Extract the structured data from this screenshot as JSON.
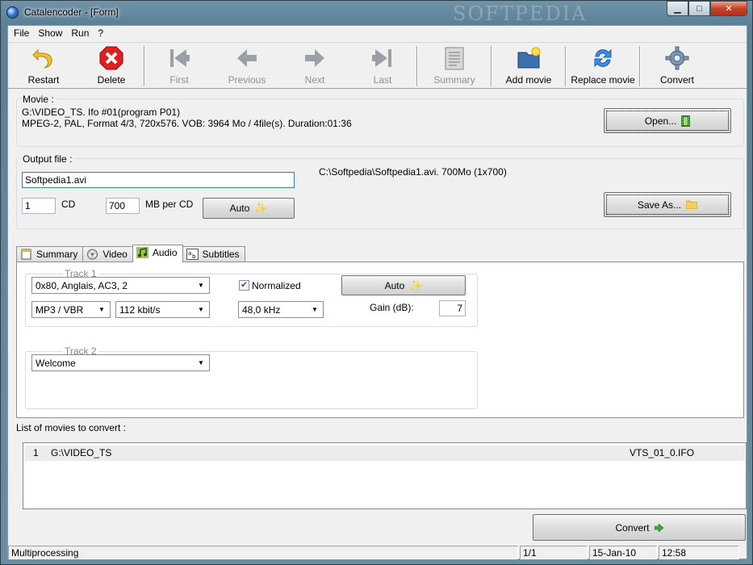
{
  "window": {
    "title": "Catalencoder - [Form]",
    "watermark": "SOFTPEDIA",
    "controls": {
      "minimize": "▁",
      "maximize": "□",
      "close": "✕"
    }
  },
  "menu": [
    "File",
    "Show",
    "Run",
    "?"
  ],
  "toolbar": {
    "restart": "Restart",
    "delete": "Delete",
    "first": "First",
    "previous": "Previous",
    "next": "Next",
    "last": "Last",
    "summary": "Summary",
    "add_movie": "Add movie",
    "replace_movie": "Replace movie",
    "convert": "Convert"
  },
  "movie": {
    "label": "Movie :",
    "line1": "G:\\VIDEO_TS. Ifo #01(program P01)",
    "line2": "MPEG-2,  PAL, Format 4/3, 720x576. VOB: 3964 Mo / 4file(s). Duration:01:36",
    "open_button": "Open..."
  },
  "output": {
    "label": "Output file :",
    "filename": "Softpedia1.avi",
    "path_info": "C:\\Softpedia\\Softpedia1.avi. 700Mo (1x700)",
    "cd_count": "1",
    "cd_label": "CD",
    "mb_value": "700",
    "mb_label": "MB per CD",
    "auto_button": "Auto",
    "save_as_button": "Save As..."
  },
  "tabs": [
    "Summary",
    "Video",
    "Audio",
    "Subtitles"
  ],
  "audio": {
    "track1": {
      "label": "Track 1",
      "stream": "0x80, Anglais,  AC3, 2",
      "codec": "MP3 / VBR",
      "bitrate": "112 kbit/s",
      "normalized_label": "Normalized",
      "normalized": true,
      "samplerate": "48,0 kHz",
      "auto_button": "Auto",
      "gain_label": "Gain (dB):",
      "gain_value": "7"
    },
    "track2": {
      "label": "Track 2",
      "stream": "Welcome"
    }
  },
  "movie_list": {
    "label": "List of movies to convert :",
    "rows": [
      {
        "index": "1",
        "path": "G:\\VIDEO_TS",
        "file": "VTS_01_0.IFO"
      }
    ]
  },
  "convert_button": "Convert",
  "status": {
    "mode": "Multiprocessing",
    "page": "1/1",
    "date": "15-Jan-10",
    "time": "12:58"
  },
  "colors": {
    "accent": "#3a7bd5",
    "delete_red": "#e02020",
    "restart_yellow": "#f2c12e",
    "disabled_gray": "#8f8f8f"
  }
}
